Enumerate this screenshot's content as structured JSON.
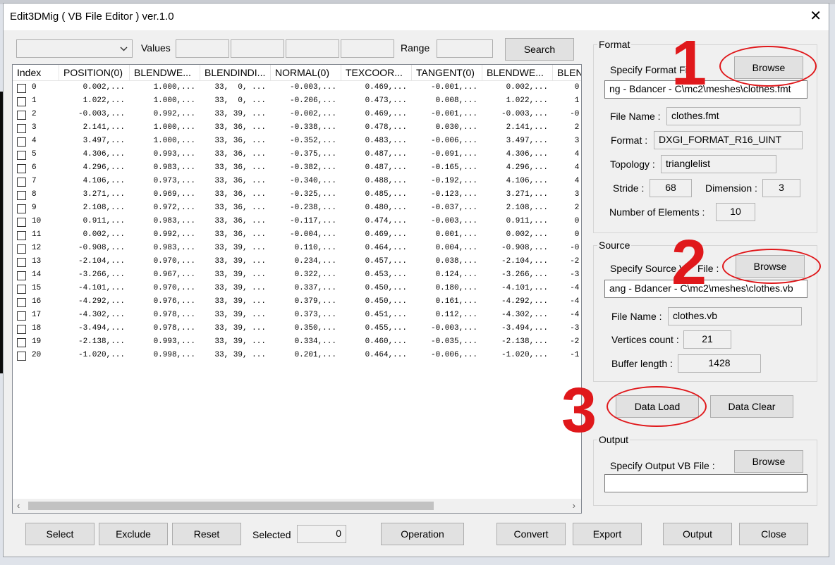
{
  "window": {
    "title": "Edit3DMig ( VB File Editor )  ver.1.0",
    "close_glyph": "✕"
  },
  "filter": {
    "dropdown_value": "",
    "values_label": "Values",
    "value_fields": [
      "",
      "",
      "",
      ""
    ],
    "range_label": "Range",
    "range_value": "",
    "search_label": "Search"
  },
  "grid": {
    "columns": [
      "Index",
      "POSITION(0)",
      "BLENDWE...",
      "BLENDINDI...",
      "NORMAL(0)",
      "TEXCOOR...",
      "TANGENT(0)",
      "BLENDWE...",
      "BLEN"
    ],
    "rows": [
      [
        "0",
        "0.002,...",
        "1.000,...",
        "33,  0, ...",
        "-0.003,...",
        "0.469,...",
        "-0.001,...",
        "0.002,...",
        "0."
      ],
      [
        "1",
        "1.022,...",
        "1.000,...",
        "33,  0, ...",
        "-0.206,...",
        "0.473,...",
        "0.008,...",
        "1.022,...",
        "1."
      ],
      [
        "2",
        "-0.003,...",
        "0.992,...",
        "33, 39, ...",
        "-0.002,...",
        "0.469,...",
        "-0.001,...",
        "-0.003,...",
        "-0."
      ],
      [
        "3",
        "2.141,...",
        "1.000,...",
        "33, 36, ...",
        "-0.338,...",
        "0.478,...",
        "0.030,...",
        "2.141,...",
        "2."
      ],
      [
        "4",
        "3.497,...",
        "1.000,...",
        "33, 36, ...",
        "-0.352,...",
        "0.483,...",
        "-0.006,...",
        "3.497,...",
        "3."
      ],
      [
        "5",
        "4.306,...",
        "0.993,...",
        "33, 36, ...",
        "-0.375,...",
        "0.487,...",
        "-0.091,...",
        "4.306,...",
        "4."
      ],
      [
        "6",
        "4.296,...",
        "0.983,...",
        "33, 36, ...",
        "-0.382,...",
        "0.487,...",
        "-0.165,...",
        "4.296,...",
        "4."
      ],
      [
        "7",
        "4.106,...",
        "0.973,...",
        "33, 36, ...",
        "-0.340,...",
        "0.488,...",
        "-0.192,...",
        "4.106,...",
        "4."
      ],
      [
        "8",
        "3.271,...",
        "0.969,...",
        "33, 36, ...",
        "-0.325,...",
        "0.485,...",
        "-0.123,...",
        "3.271,...",
        "3."
      ],
      [
        "9",
        "2.108,...",
        "0.972,...",
        "33, 36, ...",
        "-0.238,...",
        "0.480,...",
        "-0.037,...",
        "2.108,...",
        "2."
      ],
      [
        "10",
        "0.911,...",
        "0.983,...",
        "33, 36, ...",
        "-0.117,...",
        "0.474,...",
        "-0.003,...",
        "0.911,...",
        "0."
      ],
      [
        "11",
        "0.002,...",
        "0.992,...",
        "33, 36, ...",
        "-0.004,...",
        "0.469,...",
        "0.001,...",
        "0.002,...",
        "0."
      ],
      [
        "12",
        "-0.908,...",
        "0.983,...",
        "33, 39, ...",
        "0.110,...",
        "0.464,...",
        "0.004,...",
        "-0.908,...",
        "-0."
      ],
      [
        "13",
        "-2.104,...",
        "0.970,...",
        "33, 39, ...",
        "0.234,...",
        "0.457,...",
        "0.038,...",
        "-2.104,...",
        "-2."
      ],
      [
        "14",
        "-3.266,...",
        "0.967,...",
        "33, 39, ...",
        "0.322,...",
        "0.453,...",
        "0.124,...",
        "-3.266,...",
        "-3."
      ],
      [
        "15",
        "-4.101,...",
        "0.970,...",
        "33, 39, ...",
        "0.337,...",
        "0.450,...",
        "0.180,...",
        "-4.101,...",
        "-4."
      ],
      [
        "16",
        "-4.292,...",
        "0.976,...",
        "33, 39, ...",
        "0.379,...",
        "0.450,...",
        "0.161,...",
        "-4.292,...",
        "-4."
      ],
      [
        "17",
        "-4.302,...",
        "0.978,...",
        "33, 39, ...",
        "0.373,...",
        "0.451,...",
        "0.112,...",
        "-4.302,...",
        "-4."
      ],
      [
        "18",
        "-3.494,...",
        "0.978,...",
        "33, 39, ...",
        "0.350,...",
        "0.455,...",
        "-0.003,...",
        "-3.494,...",
        "-3."
      ],
      [
        "19",
        "-2.138,...",
        "0.993,...",
        "33, 39, ...",
        "0.334,...",
        "0.460,...",
        "-0.035,...",
        "-2.138,...",
        "-2."
      ],
      [
        "20",
        "-1.020,...",
        "0.998,...",
        "33, 39, ...",
        "0.201,...",
        "0.464,...",
        "-0.006,...",
        "-1.020,...",
        "-1."
      ]
    ]
  },
  "format": {
    "group_title": "Format",
    "specify_label": "Specify Format Fi",
    "browse_label": "Browse",
    "path": "ng - Bdancer - C\\mc2\\meshes\\clothes.fmt",
    "file_name_label": "File Name :",
    "file_name": "clothes.fmt",
    "format_label": "Format :",
    "format_value": "DXGI_FORMAT_R16_UINT",
    "topology_label": "Topology :",
    "topology_value": "trianglelist",
    "stride_label": "Stride :",
    "stride_value": "68",
    "dimension_label": "Dimension :",
    "dimension_value": "3",
    "num_elements_label": "Number of Elements :",
    "num_elements_value": "10"
  },
  "source": {
    "group_title": "Source",
    "specify_label": "Specify Source V",
    "specify_label_tail": "File :",
    "browse_label": "Browse",
    "path": "ang - Bdancer - C\\mc2\\meshes\\clothes.vb",
    "file_name_label": "File Name :",
    "file_name": "clothes.vb",
    "vertices_label": "Vertices count :",
    "vertices_value": "21",
    "buffer_label": "Buffer length :",
    "buffer_value": "1428"
  },
  "data_buttons": {
    "load_label": "Data Load",
    "clear_label": "Data Clear"
  },
  "output": {
    "group_title": "Output",
    "specify_label": "Specify Output VB File :",
    "browse_label": "Browse",
    "path": ""
  },
  "bottom": {
    "select_label": "Select",
    "exclude_label": "Exclude",
    "reset_label": "Reset",
    "selected_label": "Selected",
    "selected_value": "0",
    "operation_label": "Operation",
    "convert_label": "Convert",
    "export_label": "Export",
    "output_label": "Output",
    "close_label": "Close"
  },
  "annotations": {
    "step1": "1",
    "step2": "2",
    "step3": "3",
    "color": "#e0181b"
  },
  "icons": {
    "dropdown": "chevron-down-icon",
    "scroll_left": "chevron-left-icon",
    "scroll_right": "chevron-right-icon"
  }
}
